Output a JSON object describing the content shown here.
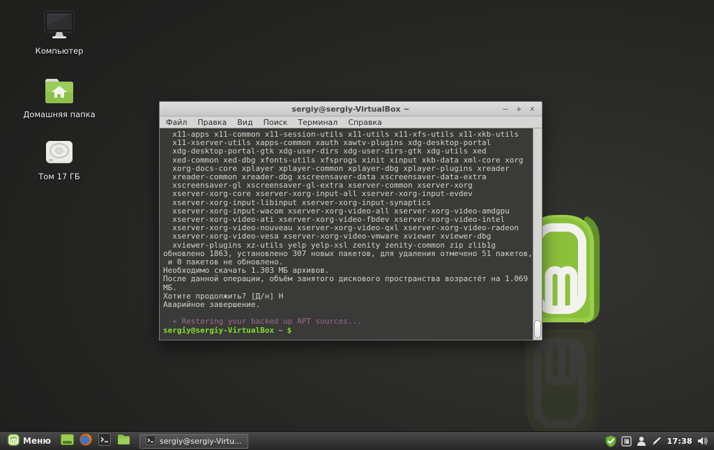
{
  "desktop": {
    "icons": [
      {
        "label": "Компьютер",
        "icon": "computer-icon"
      },
      {
        "label": "Домашняя папка",
        "icon": "home-folder-icon"
      },
      {
        "label": "Том 17 ГБ",
        "icon": "disk-icon"
      }
    ]
  },
  "terminal_window": {
    "title": "sergiy@sergiy-VirtualBox ~",
    "window_buttons": {
      "minimize": "–",
      "maximize": "+",
      "close": "×"
    },
    "menu_items": [
      "Файл",
      "Правка",
      "Вид",
      "Поиск",
      "Терминал",
      "Справка"
    ],
    "output_lines": [
      "  x11-apps x11-common x11-session-utils x11-utils x11-xfs-utils x11-xkb-utils",
      "  x11-xserver-utils xapps-common xauth xawtv-plugins xdg-desktop-portal",
      "  xdg-desktop-portal-gtk xdg-user-dirs xdg-user-dirs-gtk xdg-utils xed",
      "  xed-common xed-dbg xfonts-utils xfsprogs xinit xinput xkb-data xml-core xorg",
      "  xorg-docs-core xplayer xplayer-common xplayer-dbg xplayer-plugins xreader",
      "  xreader-common xreader-dbg xscreensaver-data xscreensaver-data-extra",
      "  xscreensaver-gl xscreensaver-gl-extra xserver-common xserver-xorg",
      "  xserver-xorg-core xserver-xorg-input-all xserver-xorg-input-evdev",
      "  xserver-xorg-input-libinput xserver-xorg-input-synaptics",
      "  xserver-xorg-input-wacom xserver-xorg-video-all xserver-xorg-video-amdgpu",
      "  xserver-xorg-video-ati xserver-xorg-video-fbdev xserver-xorg-video-intel",
      "  xserver-xorg-video-nouveau xserver-xorg-video-qxl xserver-xorg-video-radeon",
      "  xserver-xorg-video-vesa xserver-xorg-video-vmware xviewer xviewer-dbg",
      "  xviewer-plugins xz-utils yelp yelp-xsl zenity zenity-common zip zlib1g",
      "обновлено 1863, установлено 307 новых пакетов, для удаления отмечено 51 пакетов,",
      " и 0 пакетов не обновлено.",
      "Необходимо скачать 1.303 МБ архивов.",
      "После данной операции, объём занятого дискового пространства возрастёт на 1.069",
      "МБ.",
      "Хотите продолжить? [Д/н] Н",
      "Аварийное завершение.",
      ""
    ],
    "restore_line": "  + Restoring your backed up APT sources...",
    "prompt": {
      "user_host": "sergiy@sergiy-VirtualBox",
      "path": "~",
      "symbol": "$"
    }
  },
  "taskbar": {
    "menu_label": "Меню",
    "launchers": [
      "show-desktop",
      "firefox",
      "terminal",
      "file-manager"
    ],
    "window_button_label": "sergiy@sergiy-Virtu...",
    "tray_icons": [
      "update-manager-shield",
      "screen-session",
      "user-applet",
      "pen-input",
      "volume"
    ],
    "clock": "17:38"
  },
  "colors": {
    "mint_green": "#8dc63f",
    "prompt_green": "#82dd2e",
    "restore_magenta": "#9c6a90",
    "terminal_background": "#3a3a38"
  }
}
